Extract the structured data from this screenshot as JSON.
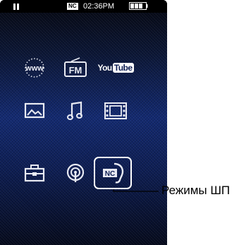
{
  "status_bar": {
    "noise_cancel_badge": "NC",
    "clock": "02:36PM",
    "icons": [
      "pause-icon",
      "noise-cancel-icon",
      "battery-icon"
    ]
  },
  "home_menu": {
    "items": [
      {
        "id": "web",
        "icon": "globe-www-icon",
        "text": "www"
      },
      {
        "id": "fm",
        "icon": "fm-radio-icon",
        "text": "FM"
      },
      {
        "id": "youtube",
        "icon": "youtube-icon",
        "text_a": "You",
        "text_b": "Tube"
      },
      {
        "id": "photo",
        "icon": "photo-icon"
      },
      {
        "id": "music",
        "icon": "music-note-icon"
      },
      {
        "id": "video",
        "icon": "film-strip-icon"
      },
      {
        "id": "settings",
        "icon": "toolbox-icon"
      },
      {
        "id": "podcast",
        "icon": "podcast-icon"
      },
      {
        "id": "noise_cancel",
        "icon": "noise-cancel-icon",
        "text": "NC",
        "selected": true
      }
    ]
  },
  "callout": {
    "label": "Режимы ШП"
  },
  "colors": {
    "screen_top": "#0b1636",
    "screen_mid": "#132a72",
    "icon": "#e8eaf2"
  }
}
